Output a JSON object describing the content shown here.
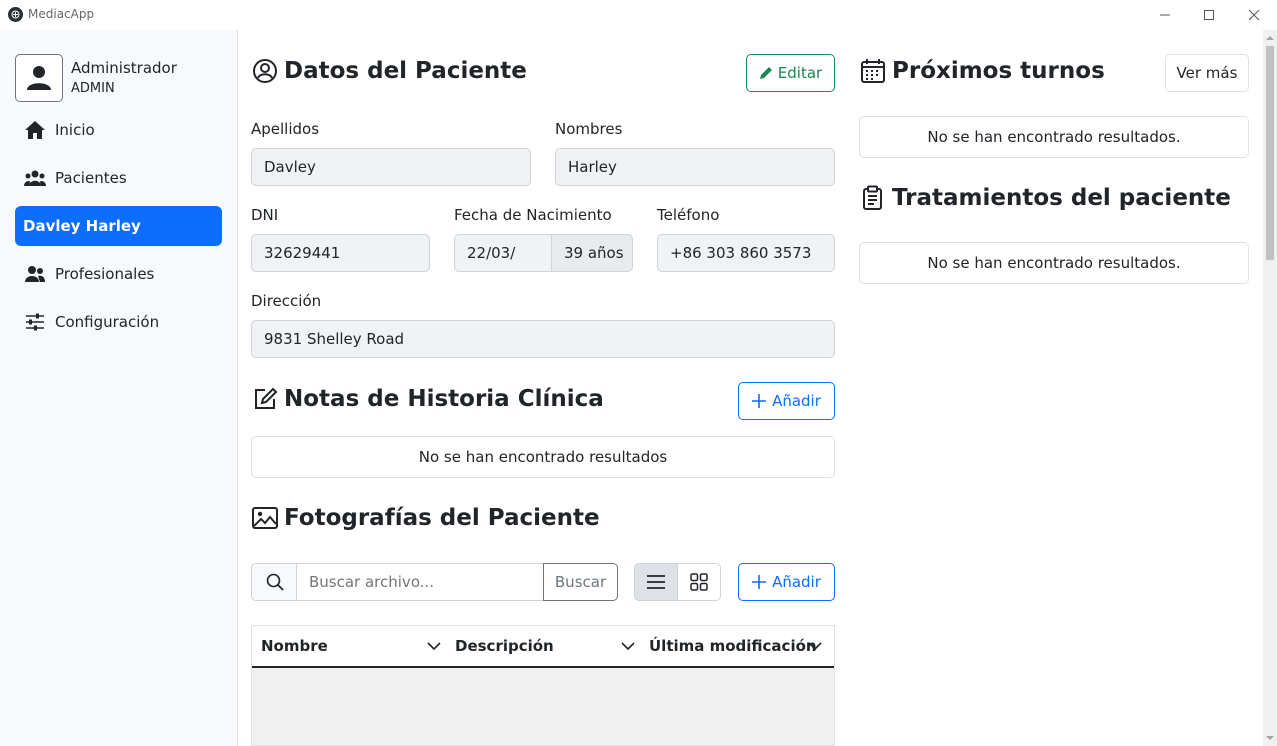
{
  "window": {
    "title": "MediacApp"
  },
  "sidebar": {
    "user": {
      "name": "Administrador",
      "role": "ADMIN"
    },
    "items": [
      {
        "label": "Inicio",
        "icon": "home-icon"
      },
      {
        "label": "Pacientes",
        "icon": "users-icon"
      },
      {
        "label": "Davley Harley",
        "active": true
      },
      {
        "label": "Profesionales",
        "icon": "user-group-icon"
      },
      {
        "label": "Configuración",
        "icon": "sliders-icon"
      }
    ]
  },
  "patient": {
    "title": "Datos del Paciente",
    "edit_label": "Editar",
    "fields": {
      "apellidos": {
        "label": "Apellidos",
        "value": "Davley"
      },
      "nombres": {
        "label": "Nombres",
        "value": "Harley"
      },
      "dni": {
        "label": "DNI",
        "value": "32629441"
      },
      "nacimiento": {
        "label": "Fecha de Nacimiento",
        "value": "22/03/",
        "age": "39 años"
      },
      "telefono": {
        "label": "Teléfono",
        "value": "+86 303 860 3573"
      },
      "direccion": {
        "label": "Dirección",
        "value": "9831 Shelley Road"
      }
    }
  },
  "notes": {
    "title": "Notas de Historia Clínica",
    "add_label": "Añadir",
    "empty": "No se han encontrado resultados"
  },
  "photos": {
    "title": "Fotografías del Paciente",
    "search_placeholder": "Buscar archivo...",
    "search_button": "Buscar",
    "add_label": "Añadir",
    "columns": [
      "Nombre",
      "Descripción",
      "Última modificación"
    ]
  },
  "appointments": {
    "title": "Próximos turnos",
    "more_label": "Ver más",
    "empty": "No se han encontrado resultados."
  },
  "treatments": {
    "title": "Tratamientos del paciente",
    "empty": "No se han encontrado resultados."
  },
  "colors": {
    "primary": "#0d6efd",
    "success": "#198754"
  }
}
